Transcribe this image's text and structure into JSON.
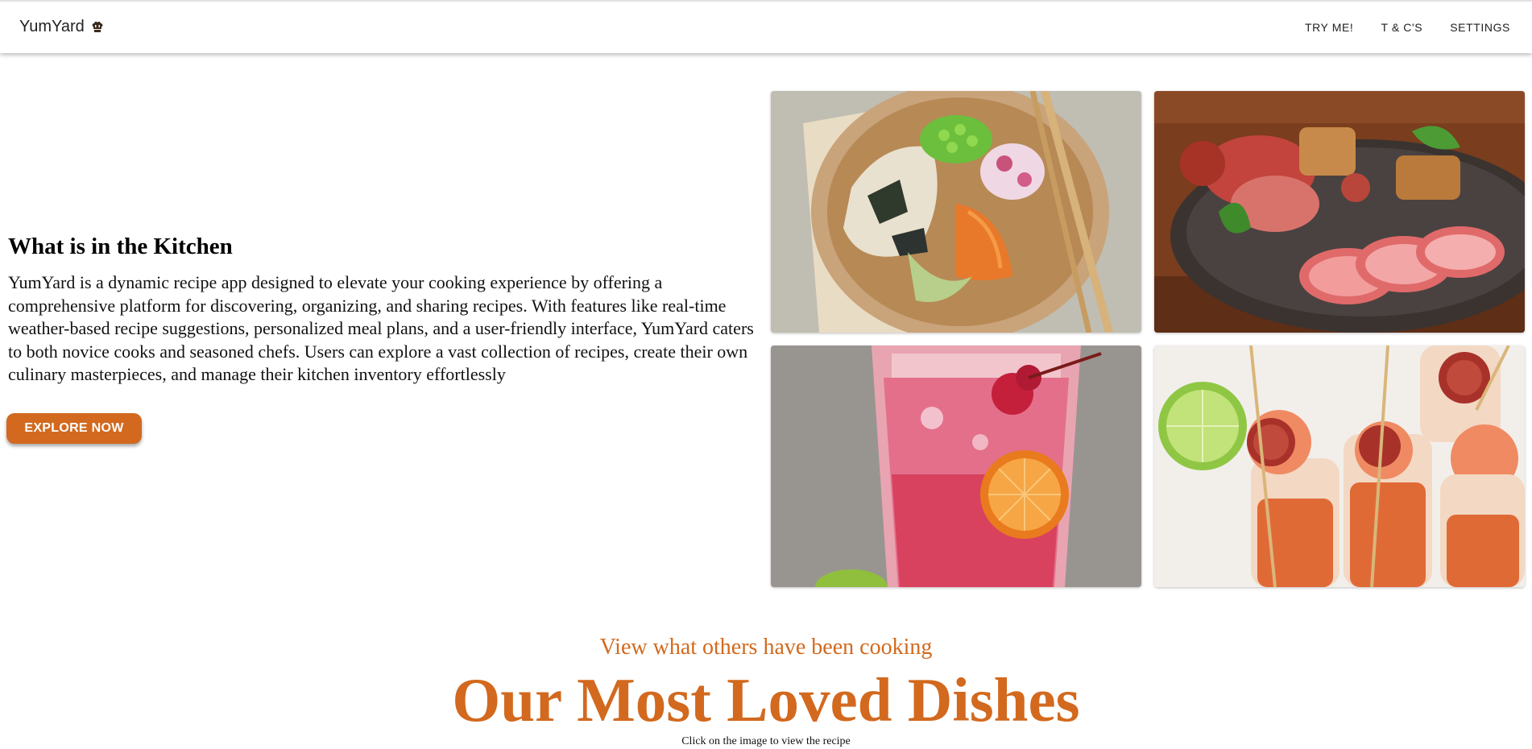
{
  "navbar": {
    "brand": "YumYard",
    "brand_icon": "chef-hat-icon",
    "links": [
      "TRY ME!",
      "T & C'S",
      "SETTINGS"
    ]
  },
  "hero": {
    "title": "What is in the Kitchen",
    "description": "YumYard is a dynamic recipe app designed to elevate your cooking experience by offering a comprehensive platform for discovering, organizing, and sharing recipes. With features like real-time weather-based recipe suggestions, personalized meal plans, and a user-friendly interface, YumYard caters to both novice cooks and seasoned chefs. Users can explore a vast collection of recipes, create their own culinary masterpieces, and manage their kitchen inventory effortlessly",
    "button": "EXPLORE NOW"
  },
  "gallery": [
    {
      "name": "grain-bowl-image"
    },
    {
      "name": "charcuterie-plate-image"
    },
    {
      "name": "pink-drink-image"
    },
    {
      "name": "shrimp-chorizo-skewers-image"
    }
  ],
  "loved": {
    "subtitle": "View what others have been cooking",
    "title": "Our Most Loved Dishes",
    "hint": "Click on the image to view the recipe"
  },
  "colors": {
    "accent": "#d2691e"
  }
}
